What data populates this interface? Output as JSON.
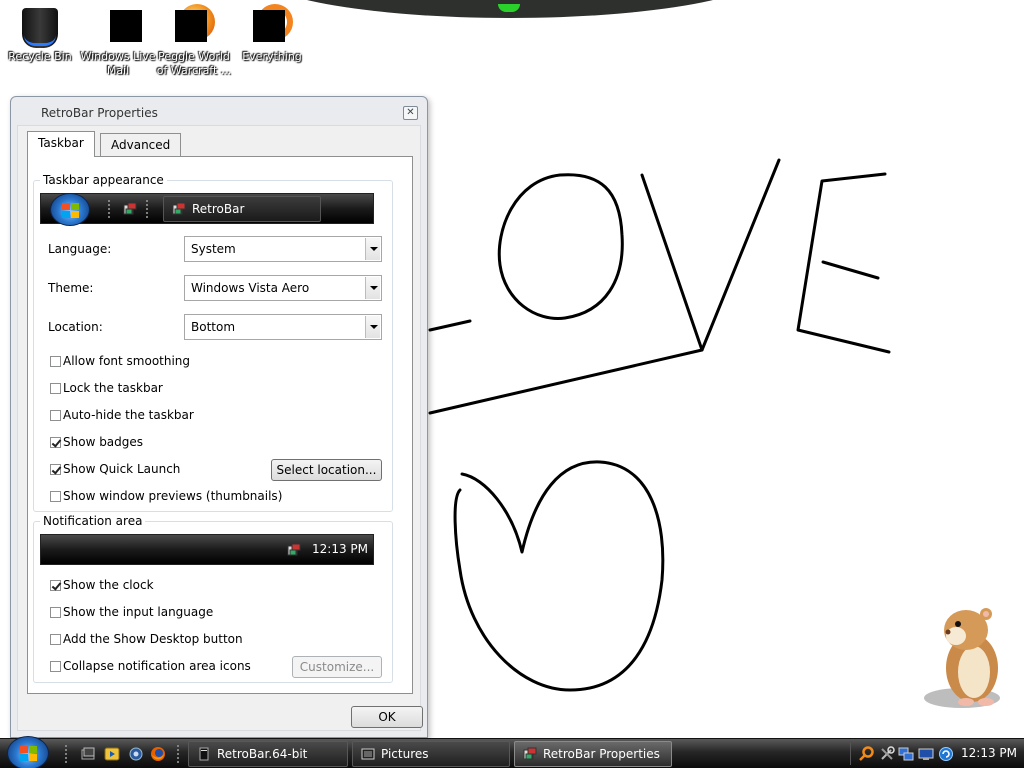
{
  "desktop": {
    "icons": [
      {
        "label": "Recycle Bin"
      },
      {
        "label": "Windows Live\nMail"
      },
      {
        "label": "Peggle World\nof Warcraft ..."
      },
      {
        "label": "Everything"
      }
    ],
    "drawing_text": "LOVE"
  },
  "dialog": {
    "title": "RetroBar Properties",
    "close_symbol": "✕",
    "tabs": [
      {
        "label": "Taskbar",
        "active": true
      },
      {
        "label": "Advanced",
        "active": false
      }
    ],
    "appearance": {
      "legend": "Taskbar appearance",
      "preview_button_label": "RetroBar",
      "language_label": "Language:",
      "language_value": "System",
      "theme_label": "Theme:",
      "theme_value": "Windows Vista Aero",
      "location_label": "Location:",
      "location_value": "Bottom",
      "options": [
        {
          "label": "Allow font smoothing",
          "checked": false
        },
        {
          "label": "Lock the taskbar",
          "checked": false
        },
        {
          "label": "Auto-hide the taskbar",
          "checked": false
        },
        {
          "label": "Show badges",
          "checked": true
        },
        {
          "label": "Show Quick Launch",
          "checked": true
        },
        {
          "label": "Show window previews (thumbnails)",
          "checked": false
        }
      ],
      "select_location_label": "Select location..."
    },
    "notification": {
      "legend": "Notification area",
      "preview_time": "12:13 PM",
      "options": [
        {
          "label": "Show the clock",
          "checked": true
        },
        {
          "label": "Show the input language",
          "checked": false
        },
        {
          "label": "Add the Show Desktop button",
          "checked": false
        },
        {
          "label": "Collapse notification area icons",
          "checked": false
        }
      ],
      "customize_label": "Customize..."
    },
    "ok_label": "OK"
  },
  "taskbar": {
    "buttons": [
      {
        "label": "RetroBar.64-bit",
        "icon": "console-icon"
      },
      {
        "label": "Pictures",
        "icon": "folder-window-icon"
      },
      {
        "label": "RetroBar Properties",
        "icon": "retrobar-icon"
      }
    ],
    "clock": "12:13 PM"
  },
  "colors": {
    "accent_blue": "#2a78d0",
    "taskbar_black": "#0b0b0b",
    "dialog_bg": "#f0f0f0"
  }
}
